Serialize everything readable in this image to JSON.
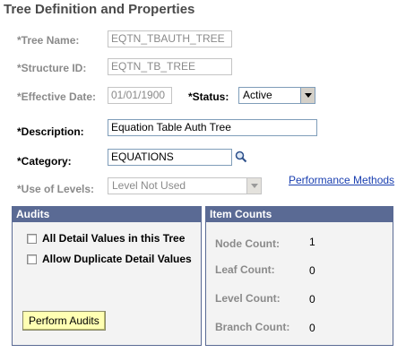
{
  "page": {
    "title": "Tree Definition and Properties"
  },
  "form": {
    "tree_name": {
      "label": "*Tree Name:",
      "value": "EQTN_TBAUTH_TREE"
    },
    "structure_id": {
      "label": "*Structure ID:",
      "value": "EQTN_TB_TREE"
    },
    "effective_date": {
      "label": "*Effective Date:",
      "value": "01/01/1900"
    },
    "status": {
      "label": "*Status:",
      "value": "Active"
    },
    "description": {
      "label": "*Description:",
      "value": "Equation Table Auth Tree"
    },
    "category": {
      "label": "*Category:",
      "value": "EQUATIONS"
    },
    "use_of_levels": {
      "label": "*Use of Levels:",
      "value": "Level Not Used"
    },
    "performance_link": "Performance Methods"
  },
  "audits": {
    "title": "Audits",
    "checkbox1": "All Detail Values in this Tree",
    "checkbox2": "Allow Duplicate Detail Values",
    "button": "Perform Audits"
  },
  "item_counts": {
    "title": "Item Counts",
    "rows": [
      {
        "label": "Node Count:",
        "value": "1"
      },
      {
        "label": "Leaf Count:",
        "value": "0"
      },
      {
        "label": "Level Count:",
        "value": "0"
      },
      {
        "label": "Branch Count:",
        "value": "0"
      }
    ]
  },
  "icons": {
    "lookup": "magnifier-icon",
    "dropdown": "chevron-down-icon"
  },
  "colors": {
    "panel_header": "#5a6a94",
    "button": "#ffffb3",
    "link": "#1a3fb0"
  }
}
